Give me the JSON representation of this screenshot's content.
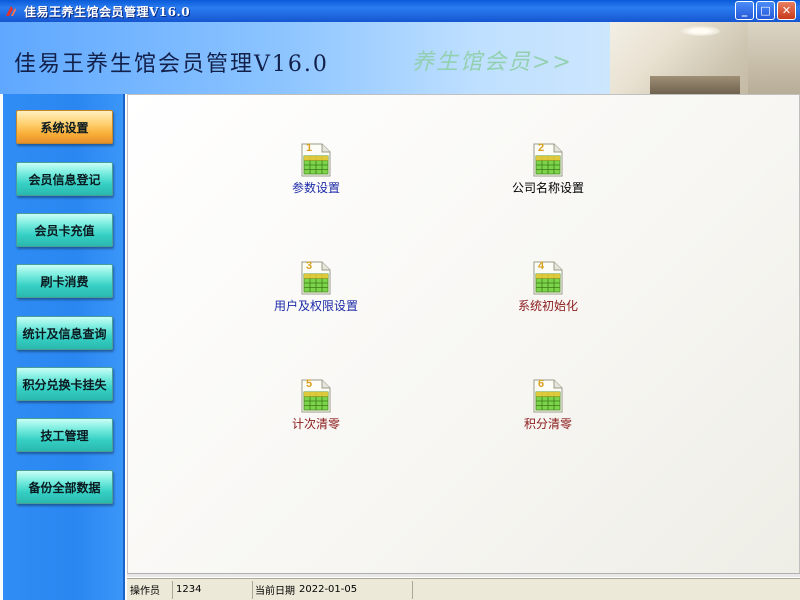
{
  "window": {
    "title": "佳易王养生馆会员管理V16.0",
    "controls": {
      "minimize": "_",
      "maximize": "□",
      "close": "✕"
    }
  },
  "banner": {
    "title": "佳易王养生馆会员管理V16.0",
    "slogan": "养生馆会员>>"
  },
  "sidebar": {
    "items": [
      {
        "label": "系统设置",
        "active": true
      },
      {
        "label": "会员信息登记",
        "active": false
      },
      {
        "label": "会员卡充值",
        "active": false
      },
      {
        "label": "刷卡消费",
        "active": false
      },
      {
        "label": "统计及信息查询",
        "active": false
      },
      {
        "label": "积分兑换卡挂失",
        "active": false
      },
      {
        "label": "技工管理",
        "active": false
      },
      {
        "label": "备份全部数据",
        "active": false
      }
    ]
  },
  "main": {
    "tiles": [
      {
        "number": "1",
        "label": "参数设置",
        "label_color": "#1c2aa8"
      },
      {
        "number": "2",
        "label": "公司名称设置",
        "label_color": "#000000"
      },
      {
        "number": "3",
        "label": "用户及权限设置",
        "label_color": "#1c2aa8"
      },
      {
        "number": "4",
        "label": "系统初始化",
        "label_color": "#8a1a1a"
      },
      {
        "number": "5",
        "label": "计次清零",
        "label_color": "#8a1a1a"
      },
      {
        "number": "6",
        "label": "积分清零",
        "label_color": "#8a1a1a"
      }
    ]
  },
  "statusbar": {
    "operator_label": "操作员",
    "operator_value": "1234",
    "date_label": "当前日期",
    "date_value": "2022-01-05"
  },
  "colors": {
    "titlebar": "#0a5ad8",
    "sidebar": "#2a86f0",
    "nav_button": "#36d0c4",
    "nav_button_active": "#f9b03a"
  }
}
